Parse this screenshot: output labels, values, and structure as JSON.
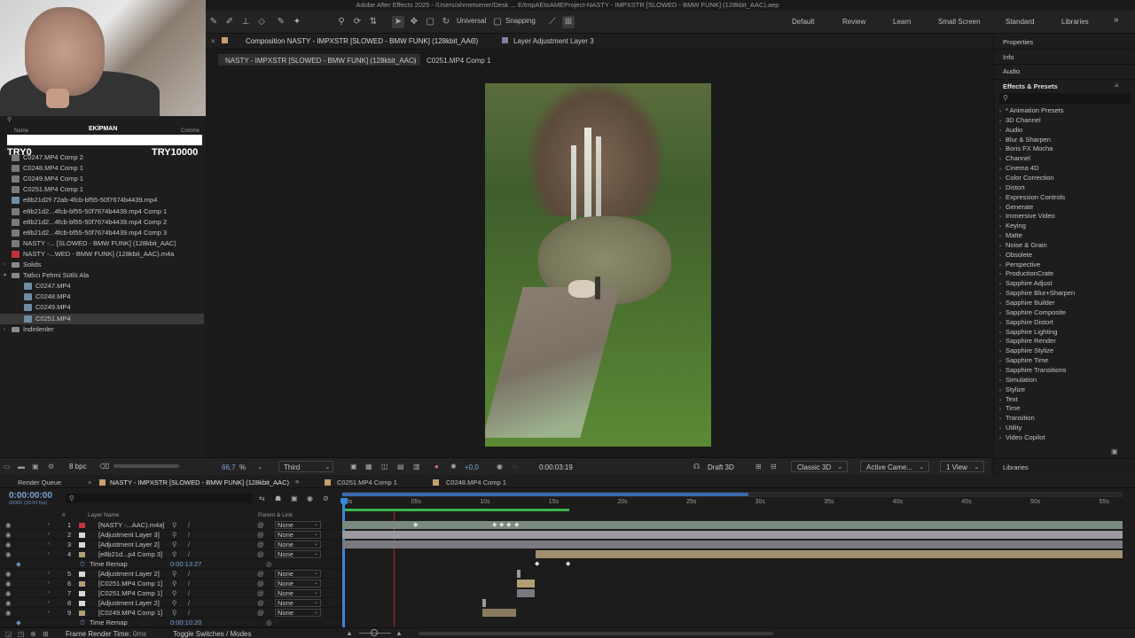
{
  "app": {
    "title": "Adobe After Effects 2025 - /Users/ahmetsener/Desk ... E/tmpAEtoAMEProject-NASTY - IMPXSTR [SLOWED - BMW FUNK] (128kbit_AAC).aep"
  },
  "toolbar": {
    "universal_label": "Universal",
    "snapping_label": "Snapping",
    "workspaces": [
      "Default",
      "Review",
      "Learn",
      "Small Screen",
      "Standard",
      "Libraries"
    ]
  },
  "overlay": {
    "left_title": "EKİPMAN",
    "left_price": "TRY0",
    "right_price": "TRY10000",
    "col_name": "Name",
    "col_comment": "Comme"
  },
  "project": {
    "items": [
      {
        "name": "C0247.MP4 Comp 2",
        "type": "comp"
      },
      {
        "name": "C0248.MP4 Comp 1",
        "type": "comp"
      },
      {
        "name": "C0249.MP4 Comp 1",
        "type": "comp"
      },
      {
        "name": "C0251.MP4 Comp 1",
        "type": "comp"
      },
      {
        "name": "e8b21d2f-72ab-4fcb-bf55-50f7674b4439.mp4",
        "type": "vid"
      },
      {
        "name": "e8b21d2...4fcb-bf55-50f7674b4439.mp4 Comp 1",
        "type": "comp"
      },
      {
        "name": "e8b21d2...4fcb-bf55-50f7674b4439.mp4 Comp 2",
        "type": "comp"
      },
      {
        "name": "e8b21d2...4fcb-bf55-50f7674b4439.mp4 Comp 3",
        "type": "comp"
      },
      {
        "name": "NASTY -... [SLOWED - BMW FUNK] (128kbit_AAC)",
        "type": "comp"
      },
      {
        "name": "NASTY -...WED - BMW FUNK] (128kbit_AAC).m4a",
        "type": "aud"
      },
      {
        "name": "Solids",
        "type": "fold"
      },
      {
        "name": "Tatlıcı Fehmi Sütlü Ala",
        "type": "fold"
      },
      {
        "name": "C0247.MP4",
        "type": "vid"
      },
      {
        "name": "C0248.MP4",
        "type": "vid"
      },
      {
        "name": "C0249.MP4",
        "type": "vid"
      },
      {
        "name": "C0251.MP4",
        "type": "vid"
      },
      {
        "name": "İndirilenler",
        "type": "fold"
      }
    ],
    "bpc": "8 bpc"
  },
  "composition": {
    "panel_title": "Composition NASTY - IMPXSTR [SLOWED - BMW FUNK] (128kbit_AAC)",
    "layer_panel": "Layer Adjustment Layer 3",
    "breadcrumbs": [
      "NASTY - IMPXSTR [SLOWED - BMW FUNK] (128kbit_AAC)",
      "C0251.MP4 Comp 1"
    ],
    "zoom": "66,7",
    "zoom_unit": "%",
    "resolution": "Third",
    "exposure": "+0,0",
    "timecode": "0:00:03:19",
    "renderer": "Draft 3D",
    "renderer_mode": "Classic 3D",
    "camera": "Active Came...",
    "views": "1 View"
  },
  "right_panel": {
    "headers": [
      "Properties",
      "Info",
      "Audio",
      "Effects & Presets"
    ],
    "effects": [
      "* Animation Presets",
      "3D Channel",
      "Audio",
      "Blur & Sharpen",
      "Boris FX Mocha",
      "Channel",
      "Cinema 4D",
      "Color Correction",
      "Distort",
      "Expression Controls",
      "Generate",
      "Immersive Video",
      "Keying",
      "Matte",
      "Noise & Grain",
      "Obsolete",
      "Perspective",
      "ProductionCrate",
      "Sapphire Adjust",
      "Sapphire Blur+Sharpen",
      "Sapphire Builder",
      "Sapphire Composite",
      "Sapphire Distort",
      "Sapphire Lighting",
      "Sapphire Render",
      "Sapphire Stylize",
      "Sapphire Time",
      "Sapphire Transitions",
      "Simulation",
      "Stylize",
      "Text",
      "Time",
      "Transition",
      "Utility",
      "Video Copilot"
    ],
    "libraries": "Libraries"
  },
  "timeline": {
    "tabs": [
      "Render Queue",
      "NASTY - IMPXSTR [SLOWED - BMW FUNK] (128kbit_AAC)",
      "C0251.MP4 Comp 1",
      "C0248.MP4 Comp 1"
    ],
    "current_time": "0:00:00:00",
    "fps": "00000 (30.00 fps)",
    "col_num": "#",
    "col_layer": "Layer Name",
    "col_parent": "Parent & Link",
    "ruler": [
      "00s",
      "05s",
      "10s",
      "15s",
      "20s",
      "25s",
      "30s",
      "35s",
      "40s",
      "45s",
      "50s",
      "55s"
    ],
    "layers": [
      {
        "num": "1",
        "name": "[NASTY -...AAC).m4a]",
        "parent": "None",
        "color": "#c2323d"
      },
      {
        "num": "2",
        "name": "[Adjustment Layer 3]",
        "parent": "None",
        "color": "#d8d8d8"
      },
      {
        "num": "3",
        "name": "[Adjustment Layer 2]",
        "parent": "None",
        "color": "#d8d8d8"
      },
      {
        "num": "4",
        "name": "[e8b21d...p4 Comp 3]",
        "parent": "None",
        "color": "#b0a074"
      },
      {
        "num": "",
        "name": "Time Remap",
        "parent": "",
        "color": "",
        "time": "0:00:13:27"
      },
      {
        "num": "5",
        "name": "[Adjustment Layer 2]",
        "parent": "None",
        "color": "#d8d8d8"
      },
      {
        "num": "6",
        "name": "[C0251.MP4 Comp 1]",
        "parent": "None",
        "color": "#b0a074"
      },
      {
        "num": "7",
        "name": "[C0251.MP4 Comp 1]",
        "parent": "None",
        "color": "#d8d8d8"
      },
      {
        "num": "8",
        "name": "[Adjustment Layer 2]",
        "parent": "None",
        "color": "#d8d8d8"
      },
      {
        "num": "9",
        "name": "[C0249.MP4 Comp 1]",
        "parent": "None",
        "color": "#b0a074"
      },
      {
        "num": "",
        "name": "Time Remap",
        "parent": "",
        "color": "",
        "time": "0:00:10:20"
      }
    ],
    "frame_render": "Frame Render Time:",
    "frame_render_value": "0ms",
    "toggle": "Toggle Switches / Modes"
  }
}
